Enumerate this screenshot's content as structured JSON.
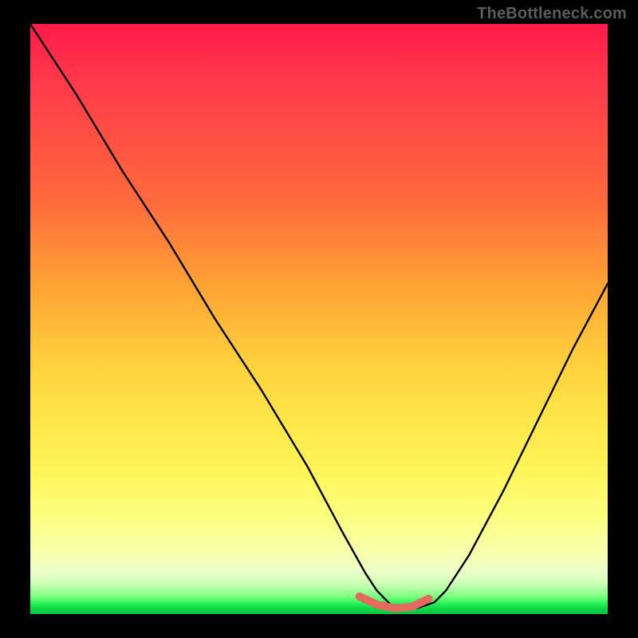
{
  "watermark": "TheBottleneck.com",
  "chart_data": {
    "type": "line",
    "title": "",
    "xlabel": "",
    "ylabel": "",
    "xlim": [
      0,
      100
    ],
    "ylim": [
      0,
      100
    ],
    "grid": false,
    "legend": false,
    "description": "Vertical red→yellow→green heat gradient with a black V-shaped curve; minimum (green zone) highlighted by a short salmon segment near the bottom.",
    "series": [
      {
        "name": "bottleneck-curve",
        "color": "#000000",
        "x": [
          0,
          8,
          16,
          24,
          32,
          40,
          48,
          54,
          58,
          60,
          63,
          67,
          70,
          72,
          76,
          82,
          88,
          94,
          100
        ],
        "values": [
          100,
          88,
          75,
          63,
          50,
          38,
          25,
          14,
          7,
          4,
          1,
          1,
          2,
          4,
          10,
          21,
          33,
          45,
          56
        ]
      },
      {
        "name": "optimal-range-marker",
        "color": "#e46a5e",
        "x": [
          57,
          60,
          63,
          66,
          69
        ],
        "values": [
          3,
          1.6,
          1,
          1.2,
          2.6
        ]
      }
    ],
    "gradient_stops": [
      {
        "pos": 0.0,
        "color": "#ff1a4a"
      },
      {
        "pos": 0.3,
        "color": "#ff6a3d"
      },
      {
        "pos": 0.58,
        "color": "#ffd23c"
      },
      {
        "pos": 0.84,
        "color": "#fcff82"
      },
      {
        "pos": 0.95,
        "color": "#c9ffb4"
      },
      {
        "pos": 1.0,
        "color": "#08c542"
      }
    ]
  }
}
